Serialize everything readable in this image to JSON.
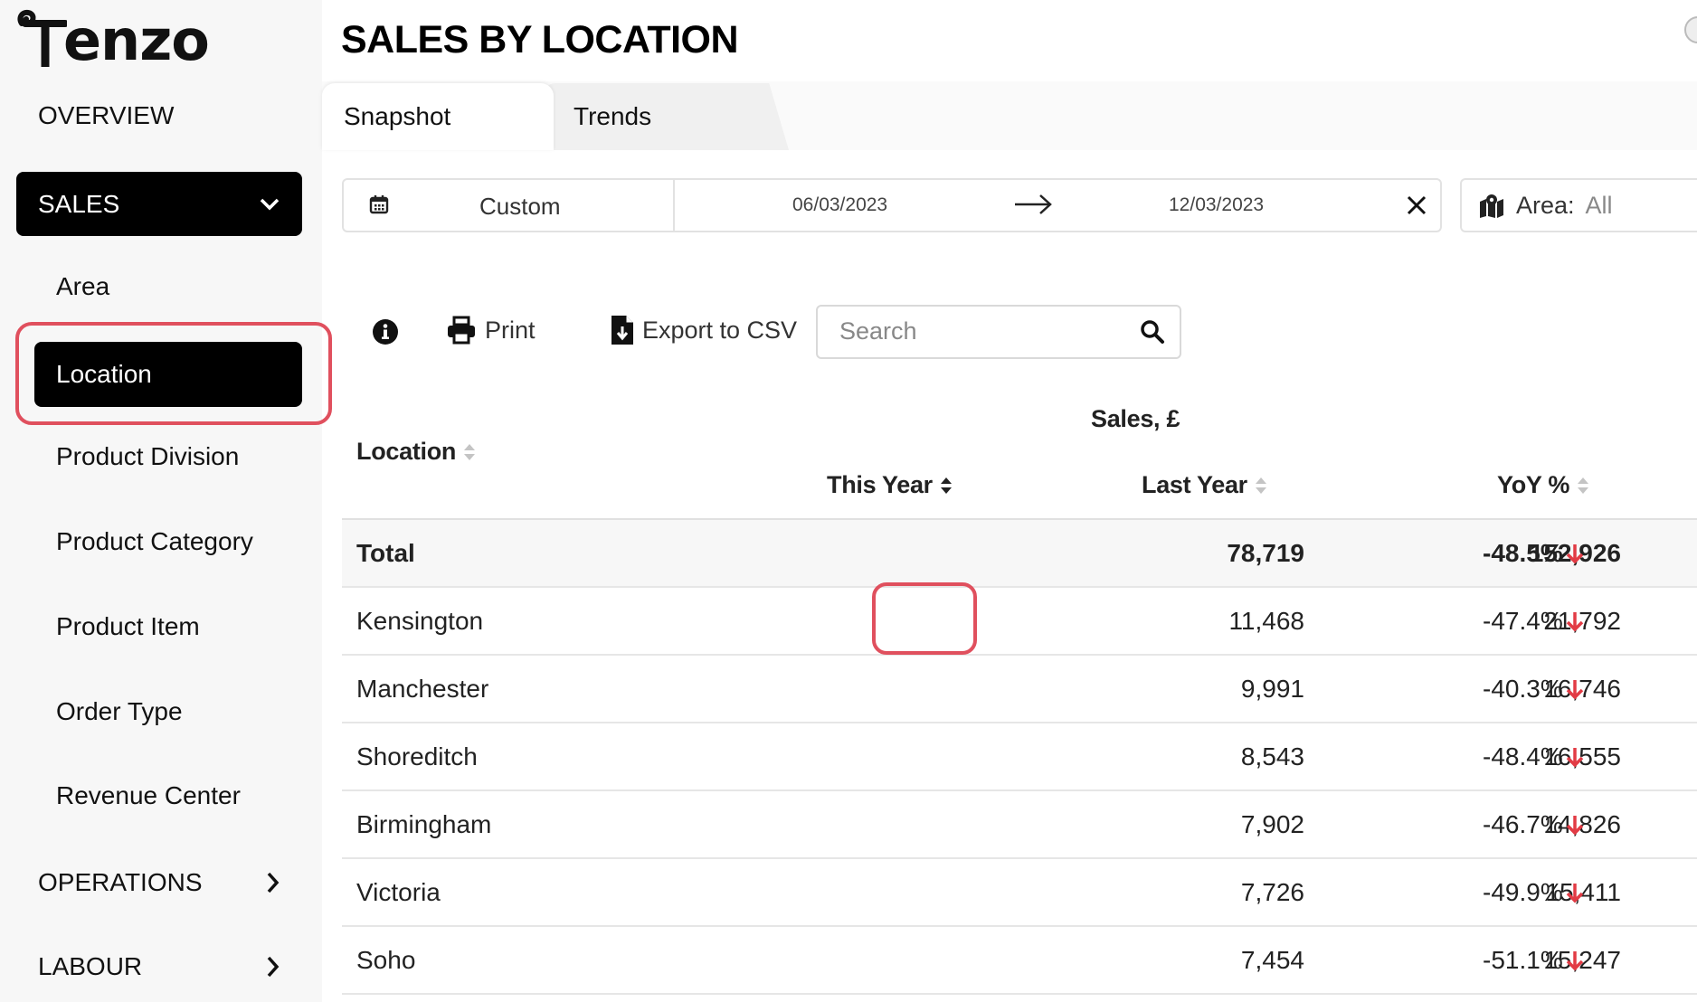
{
  "app": {
    "logo_text": "enzo"
  },
  "sidebar": {
    "overview": "OVERVIEW",
    "sales": "SALES",
    "sales_sub": [
      "Area",
      "Location",
      "Product Division",
      "Product Category",
      "Product Item",
      "Order Type",
      "Revenue Center"
    ],
    "active_item": "Location",
    "operations": "OPERATIONS",
    "labour": "LABOUR"
  },
  "page": {
    "title": "SALES BY LOCATION"
  },
  "tabs": [
    {
      "label": "Snapshot",
      "active": true
    },
    {
      "label": "Trends",
      "active": false
    }
  ],
  "filters": {
    "date_mode": "Custom",
    "date_from": "06/03/2023",
    "date_to": "12/03/2023",
    "area_label": "Area:",
    "area_value": "All"
  },
  "toolbar": {
    "print": "Print",
    "export": "Export to CSV",
    "search_placeholder": "Search"
  },
  "table": {
    "group_header": "Sales, £",
    "columns": {
      "location": "Location",
      "this_year": "This Year",
      "last_year": "Last Year",
      "yoy": "YoY %"
    },
    "total": {
      "location": "Total",
      "this_year": "78,719",
      "last_year": "152,926",
      "yoy": "-48.5%"
    },
    "rows": [
      {
        "location": "Kensington",
        "this_year": "11,468",
        "last_year": "21,792",
        "yoy": "-47.4%"
      },
      {
        "location": "Manchester",
        "this_year": "9,991",
        "last_year": "16,746",
        "yoy": "-40.3%"
      },
      {
        "location": "Shoreditch",
        "this_year": "8,543",
        "last_year": "16,555",
        "yoy": "-48.4%"
      },
      {
        "location": "Birmingham",
        "this_year": "7,902",
        "last_year": "14,826",
        "yoy": "-46.7%"
      },
      {
        "location": "Victoria",
        "this_year": "7,726",
        "last_year": "15,411",
        "yoy": "-49.9%"
      },
      {
        "location": "Soho",
        "this_year": "7,454",
        "last_year": "15,247",
        "yoy": "-51.1%"
      }
    ]
  },
  "colors": {
    "accent_red": "#e0505e",
    "down_arrow": "#e23b45",
    "active_bg": "#000000"
  }
}
